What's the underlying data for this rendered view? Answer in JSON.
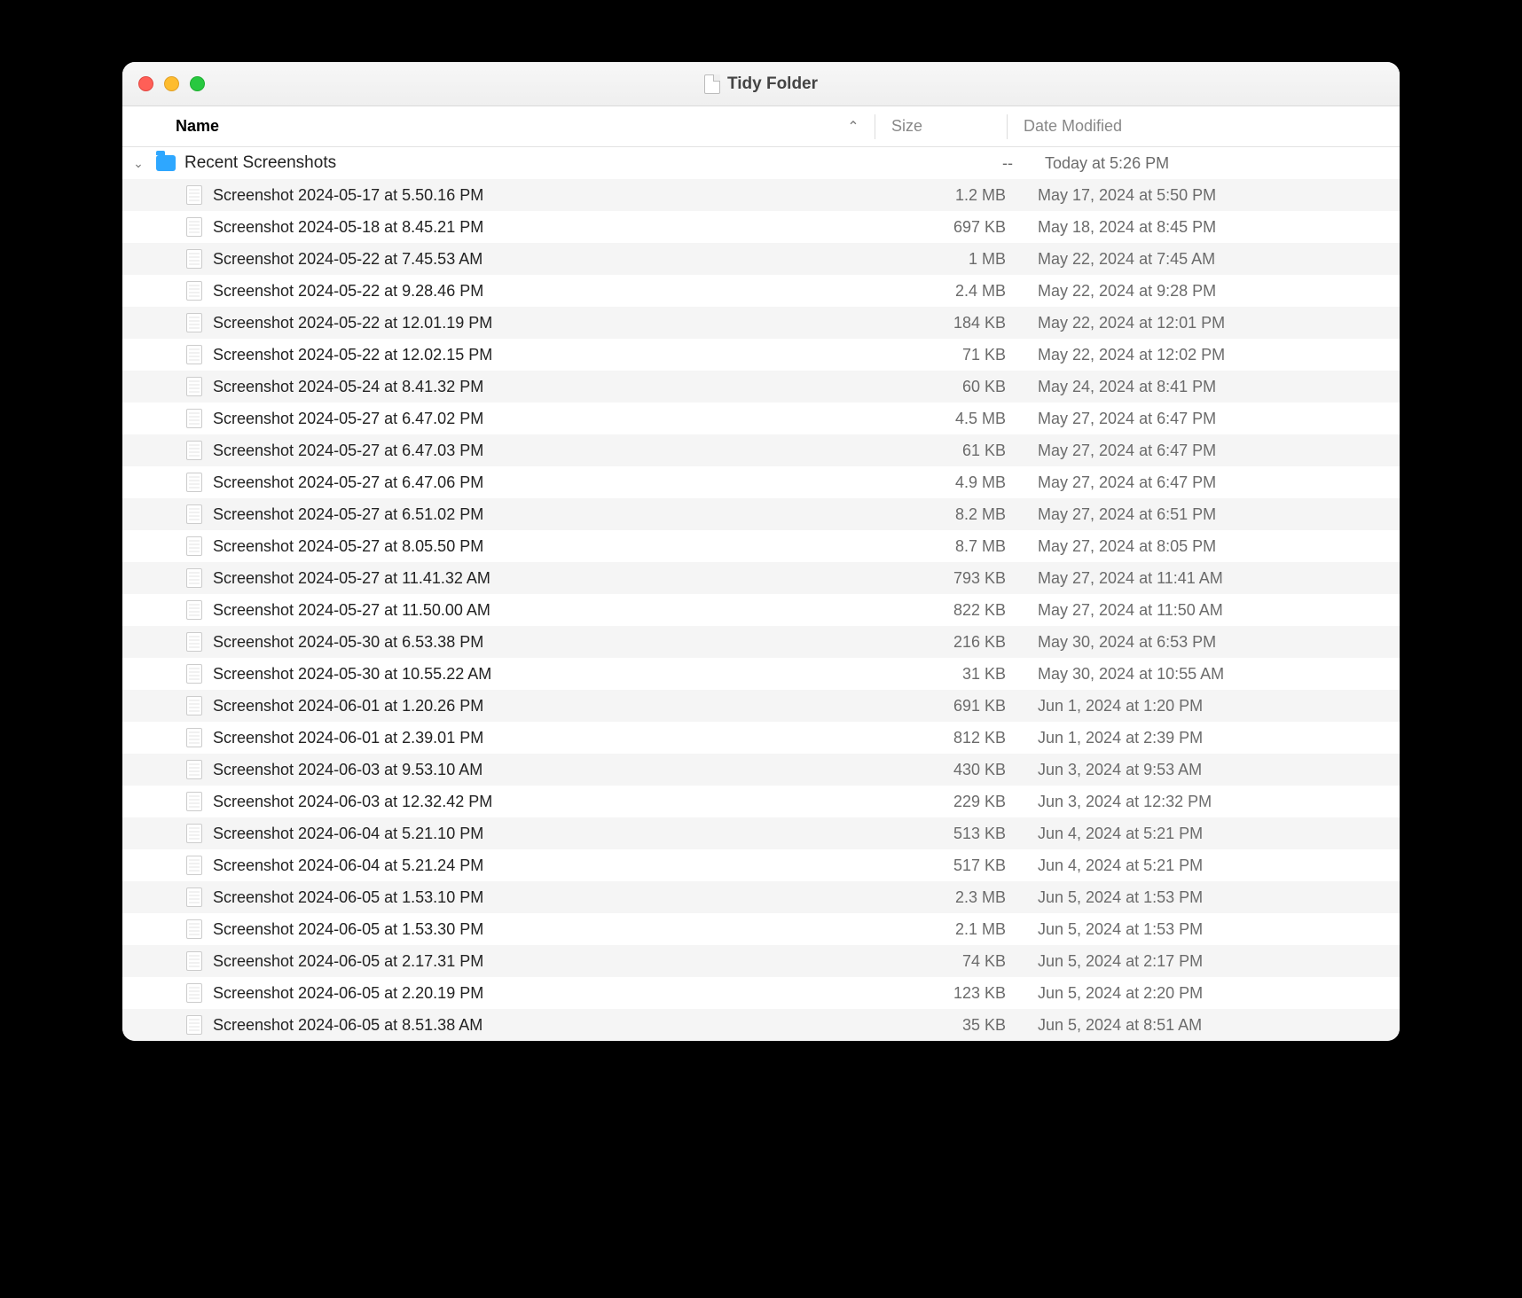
{
  "window": {
    "title": "Tidy Folder"
  },
  "columns": {
    "name": "Name",
    "size": "Size",
    "date": "Date Modified"
  },
  "folder": {
    "name": "Recent Screenshots",
    "size": "--",
    "date": "Today at 5:26 PM"
  },
  "files": [
    {
      "name": "Screenshot 2024-05-17 at 5.50.16 PM",
      "size": "1.2 MB",
      "date": "May 17, 2024 at 5:50 PM"
    },
    {
      "name": "Screenshot 2024-05-18 at 8.45.21 PM",
      "size": "697 KB",
      "date": "May 18, 2024 at 8:45 PM"
    },
    {
      "name": "Screenshot 2024-05-22 at 7.45.53 AM",
      "size": "1 MB",
      "date": "May 22, 2024 at 7:45 AM"
    },
    {
      "name": "Screenshot 2024-05-22 at 9.28.46 PM",
      "size": "2.4 MB",
      "date": "May 22, 2024 at 9:28 PM"
    },
    {
      "name": "Screenshot 2024-05-22 at 12.01.19 PM",
      "size": "184 KB",
      "date": "May 22, 2024 at 12:01 PM"
    },
    {
      "name": "Screenshot 2024-05-22 at 12.02.15 PM",
      "size": "71 KB",
      "date": "May 22, 2024 at 12:02 PM"
    },
    {
      "name": "Screenshot 2024-05-24 at 8.41.32 PM",
      "size": "60 KB",
      "date": "May 24, 2024 at 8:41 PM"
    },
    {
      "name": "Screenshot 2024-05-27 at 6.47.02 PM",
      "size": "4.5 MB",
      "date": "May 27, 2024 at 6:47 PM"
    },
    {
      "name": "Screenshot 2024-05-27 at 6.47.03 PM",
      "size": "61 KB",
      "date": "May 27, 2024 at 6:47 PM"
    },
    {
      "name": "Screenshot 2024-05-27 at 6.47.06 PM",
      "size": "4.9 MB",
      "date": "May 27, 2024 at 6:47 PM"
    },
    {
      "name": "Screenshot 2024-05-27 at 6.51.02 PM",
      "size": "8.2 MB",
      "date": "May 27, 2024 at 6:51 PM"
    },
    {
      "name": "Screenshot 2024-05-27 at 8.05.50 PM",
      "size": "8.7 MB",
      "date": "May 27, 2024 at 8:05 PM"
    },
    {
      "name": "Screenshot 2024-05-27 at 11.41.32 AM",
      "size": "793 KB",
      "date": "May 27, 2024 at 11:41 AM"
    },
    {
      "name": "Screenshot 2024-05-27 at 11.50.00 AM",
      "size": "822 KB",
      "date": "May 27, 2024 at 11:50 AM"
    },
    {
      "name": "Screenshot 2024-05-30 at 6.53.38 PM",
      "size": "216 KB",
      "date": "May 30, 2024 at 6:53 PM"
    },
    {
      "name": "Screenshot 2024-05-30 at 10.55.22 AM",
      "size": "31 KB",
      "date": "May 30, 2024 at 10:55 AM"
    },
    {
      "name": "Screenshot 2024-06-01 at 1.20.26 PM",
      "size": "691 KB",
      "date": "Jun 1, 2024 at 1:20 PM"
    },
    {
      "name": "Screenshot 2024-06-01 at 2.39.01 PM",
      "size": "812 KB",
      "date": "Jun 1, 2024 at 2:39 PM"
    },
    {
      "name": "Screenshot 2024-06-03 at 9.53.10 AM",
      "size": "430 KB",
      "date": "Jun 3, 2024 at 9:53 AM"
    },
    {
      "name": "Screenshot 2024-06-03 at 12.32.42 PM",
      "size": "229 KB",
      "date": "Jun 3, 2024 at 12:32 PM"
    },
    {
      "name": "Screenshot 2024-06-04 at 5.21.10 PM",
      "size": "513 KB",
      "date": "Jun 4, 2024 at 5:21 PM"
    },
    {
      "name": "Screenshot 2024-06-04 at 5.21.24 PM",
      "size": "517 KB",
      "date": "Jun 4, 2024 at 5:21 PM"
    },
    {
      "name": "Screenshot 2024-06-05 at 1.53.10 PM",
      "size": "2.3 MB",
      "date": "Jun 5, 2024 at 1:53 PM"
    },
    {
      "name": "Screenshot 2024-06-05 at 1.53.30 PM",
      "size": "2.1 MB",
      "date": "Jun 5, 2024 at 1:53 PM"
    },
    {
      "name": "Screenshot 2024-06-05 at 2.17.31 PM",
      "size": "74 KB",
      "date": "Jun 5, 2024 at 2:17 PM"
    },
    {
      "name": "Screenshot 2024-06-05 at 2.20.19 PM",
      "size": "123 KB",
      "date": "Jun 5, 2024 at 2:20 PM"
    },
    {
      "name": "Screenshot 2024-06-05 at 8.51.38 AM",
      "size": "35 KB",
      "date": "Jun 5, 2024 at 8:51 AM"
    }
  ]
}
